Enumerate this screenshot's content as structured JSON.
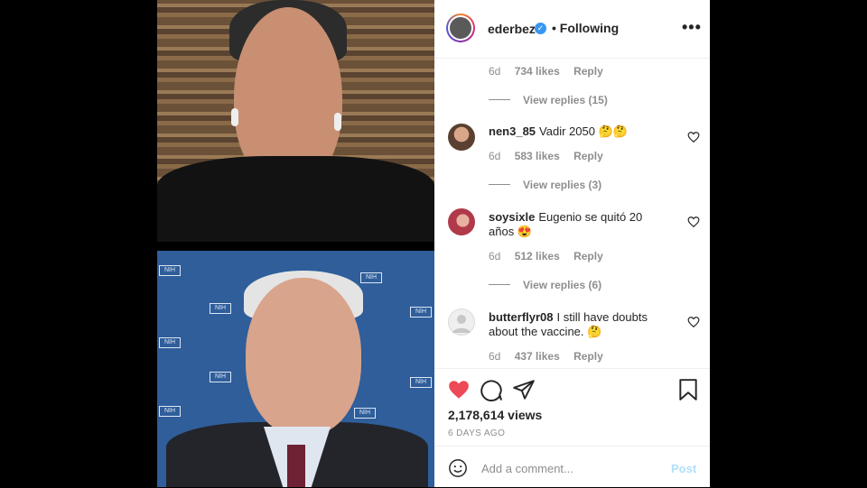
{
  "post": {
    "username": "ederbez",
    "separator": "•",
    "follow_state": "Following",
    "more_label": "•••"
  },
  "comments_top": {
    "time": "6d",
    "likes": "734 likes",
    "reply": "Reply",
    "view_replies": "View replies (15)"
  },
  "comments": [
    {
      "user": "nen3_85",
      "text": "Vadir 2050 🤔🤔",
      "time": "6d",
      "likes": "583 likes",
      "reply": "Reply",
      "view_replies": "View replies (3)"
    },
    {
      "user": "soysixle",
      "text": "Eugenio se quitó 20 años 😍",
      "time": "6d",
      "likes": "512 likes",
      "reply": "Reply",
      "view_replies": "View replies (6)"
    },
    {
      "user": "butterflyr08",
      "text": "I still have doubts about the vaccine. 🤔",
      "time": "6d",
      "likes": "437 likes",
      "reply": "Reply"
    }
  ],
  "stats": {
    "views": "2,178,614 views",
    "posted": "6 DAYS AGO"
  },
  "add_comment": {
    "placeholder": "Add a comment...",
    "post_label": "Post"
  },
  "video": {
    "logo_text": "NIH"
  },
  "colors": {
    "like_red": "#ed4956",
    "verified_blue": "#3897f0",
    "post_disabled": "#b2dffc",
    "secondary_text": "#8e8e8e"
  },
  "icons": [
    "verified-badge-icon",
    "more-options-icon",
    "heart-icon",
    "comment-icon",
    "share-icon",
    "bookmark-icon",
    "emoji-icon"
  ]
}
